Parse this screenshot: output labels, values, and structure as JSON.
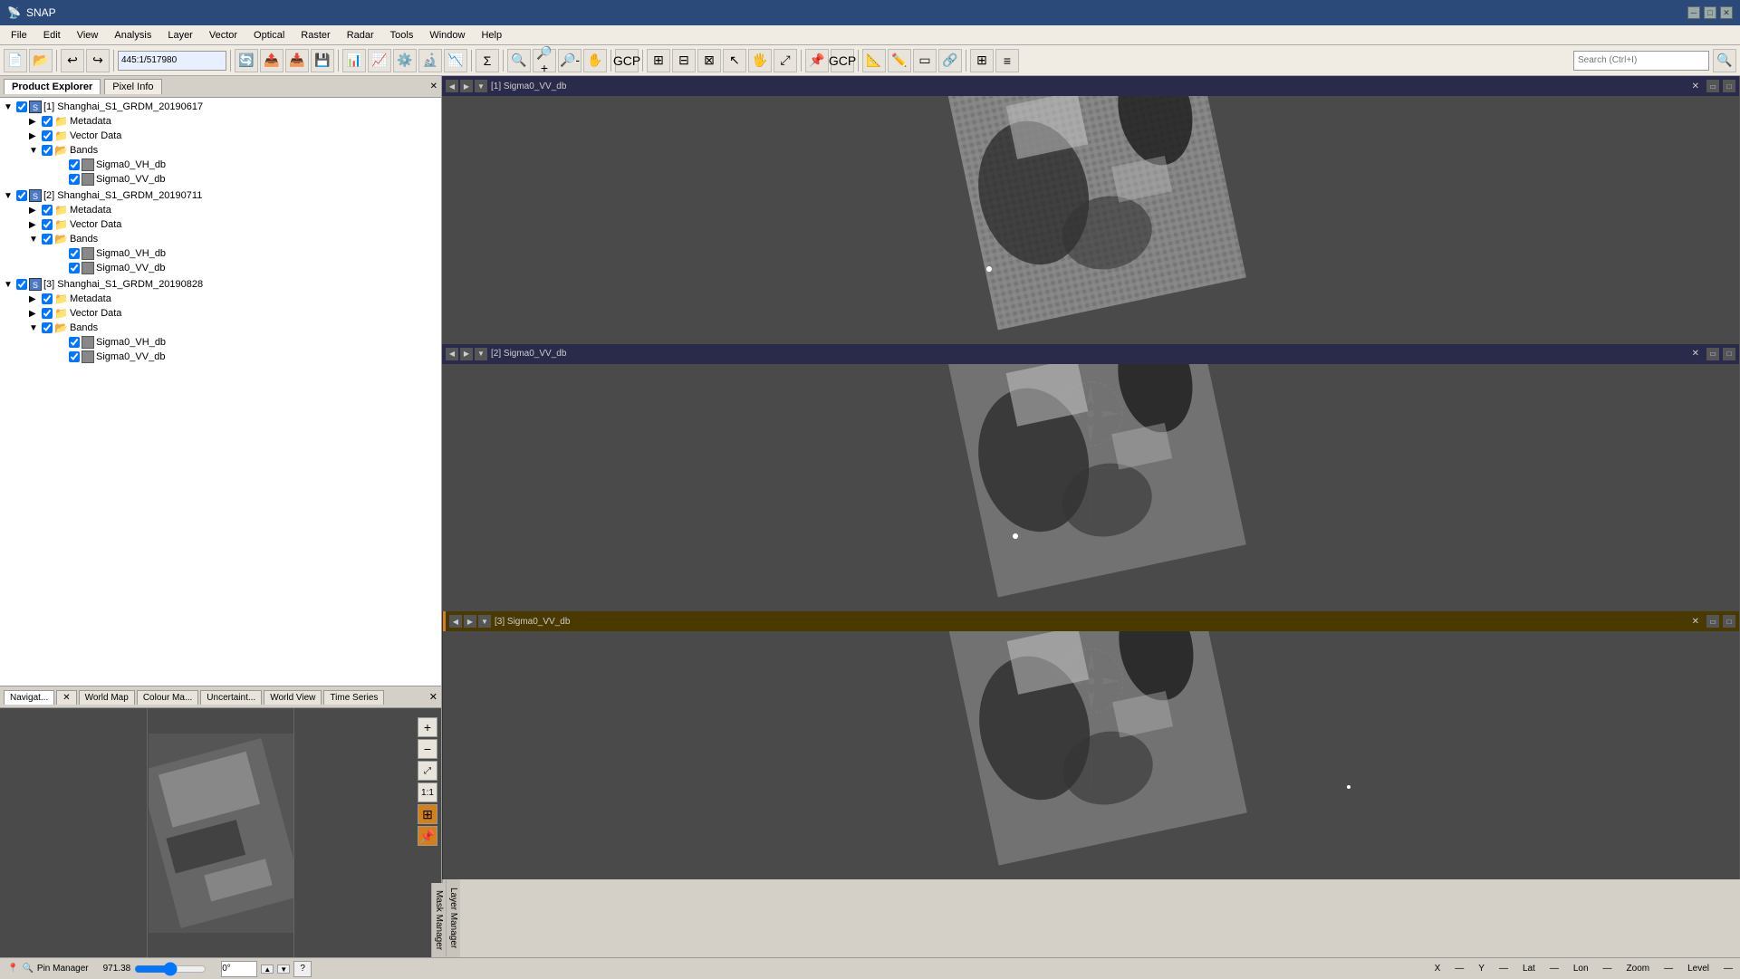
{
  "app": {
    "title": "SNAP",
    "icon": "📡"
  },
  "menu": {
    "items": [
      "File",
      "Edit",
      "View",
      "Analysis",
      "Layer",
      "Vector",
      "Optical",
      "Raster",
      "Radar",
      "Tools",
      "Window",
      "Help"
    ]
  },
  "toolbar": {
    "zoom_value": "445:1/517980",
    "search_placeholder": "Search (Ctrl+I)"
  },
  "product_explorer": {
    "tab": "Product Explorer",
    "pixel_info_tab": "Pixel Info",
    "datasets": [
      {
        "id": "[1] Shanghai_S1_GRDM_20190617",
        "children": [
          {
            "label": "Metadata",
            "type": "folder"
          },
          {
            "label": "Vector Data",
            "type": "folder"
          },
          {
            "label": "Bands",
            "type": "folder",
            "children": [
              {
                "label": "Sigma0_VH_db",
                "type": "band"
              },
              {
                "label": "Sigma0_VV_db",
                "type": "band"
              }
            ]
          }
        ]
      },
      {
        "id": "[2] Shanghai_S1_GRDM_20190711",
        "children": [
          {
            "label": "Metadata",
            "type": "folder"
          },
          {
            "label": "Vector Data",
            "type": "folder"
          },
          {
            "label": "Bands",
            "type": "folder",
            "children": [
              {
                "label": "Sigma0_VH_db",
                "type": "band"
              },
              {
                "label": "Sigma0_VV_db",
                "type": "band"
              }
            ]
          }
        ]
      },
      {
        "id": "[3] Shanghai_S1_GRDM_20190828",
        "children": [
          {
            "label": "Metadata",
            "type": "folder"
          },
          {
            "label": "Vector Data",
            "type": "folder"
          },
          {
            "label": "Bands",
            "type": "folder",
            "children": [
              {
                "label": "Sigma0_VH_db",
                "type": "band"
              },
              {
                "label": "Sigma0_VV_db",
                "type": "band"
              }
            ]
          }
        ]
      }
    ]
  },
  "navigator": {
    "tabs": [
      "Navigat...",
      "World Map",
      "Colour Ma...",
      "Uncertaint...",
      "World View",
      "Time Series"
    ],
    "active_tab": "Navigat..."
  },
  "viewers": [
    {
      "id": "[1] Sigma0_VV_db",
      "index": 1
    },
    {
      "id": "[2] Sigma0_VV_db",
      "index": 2
    },
    {
      "id": "[3] Sigma0_VV_db",
      "index": 3
    }
  ],
  "status_bar": {
    "value": "971.38",
    "angle": "0°",
    "x_label": "X",
    "y_label": "Y",
    "lat_label": "Lat",
    "lon_label": "Lon",
    "zoom_label": "Zoom",
    "level_label": "Level",
    "pin_manager": "Pin Manager"
  },
  "side_tabs": [
    "Layer",
    "Mask",
    "Manager"
  ]
}
